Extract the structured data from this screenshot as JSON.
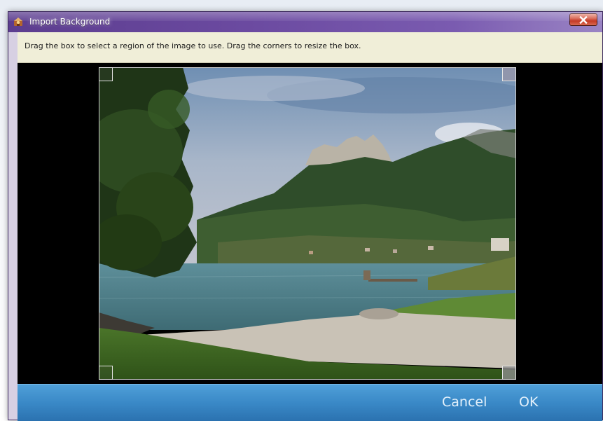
{
  "window": {
    "title": "Import Background",
    "colors": {
      "titlebar_start": "#5c3d8f",
      "titlebar_end": "#9a84c4",
      "close_button": "#c2301c",
      "instruction_bg": "#f0eed8",
      "footer_bg": "#3a89c7"
    }
  },
  "instructions": {
    "text": "Drag the box to select a region of the image to use. Drag the corners to resize the box."
  },
  "image": {
    "description_icon": "landscape-photo"
  },
  "footer": {
    "cancel_label": "Cancel",
    "ok_label": "OK"
  },
  "icons": {
    "app": "app-icon",
    "close": "close-icon"
  }
}
